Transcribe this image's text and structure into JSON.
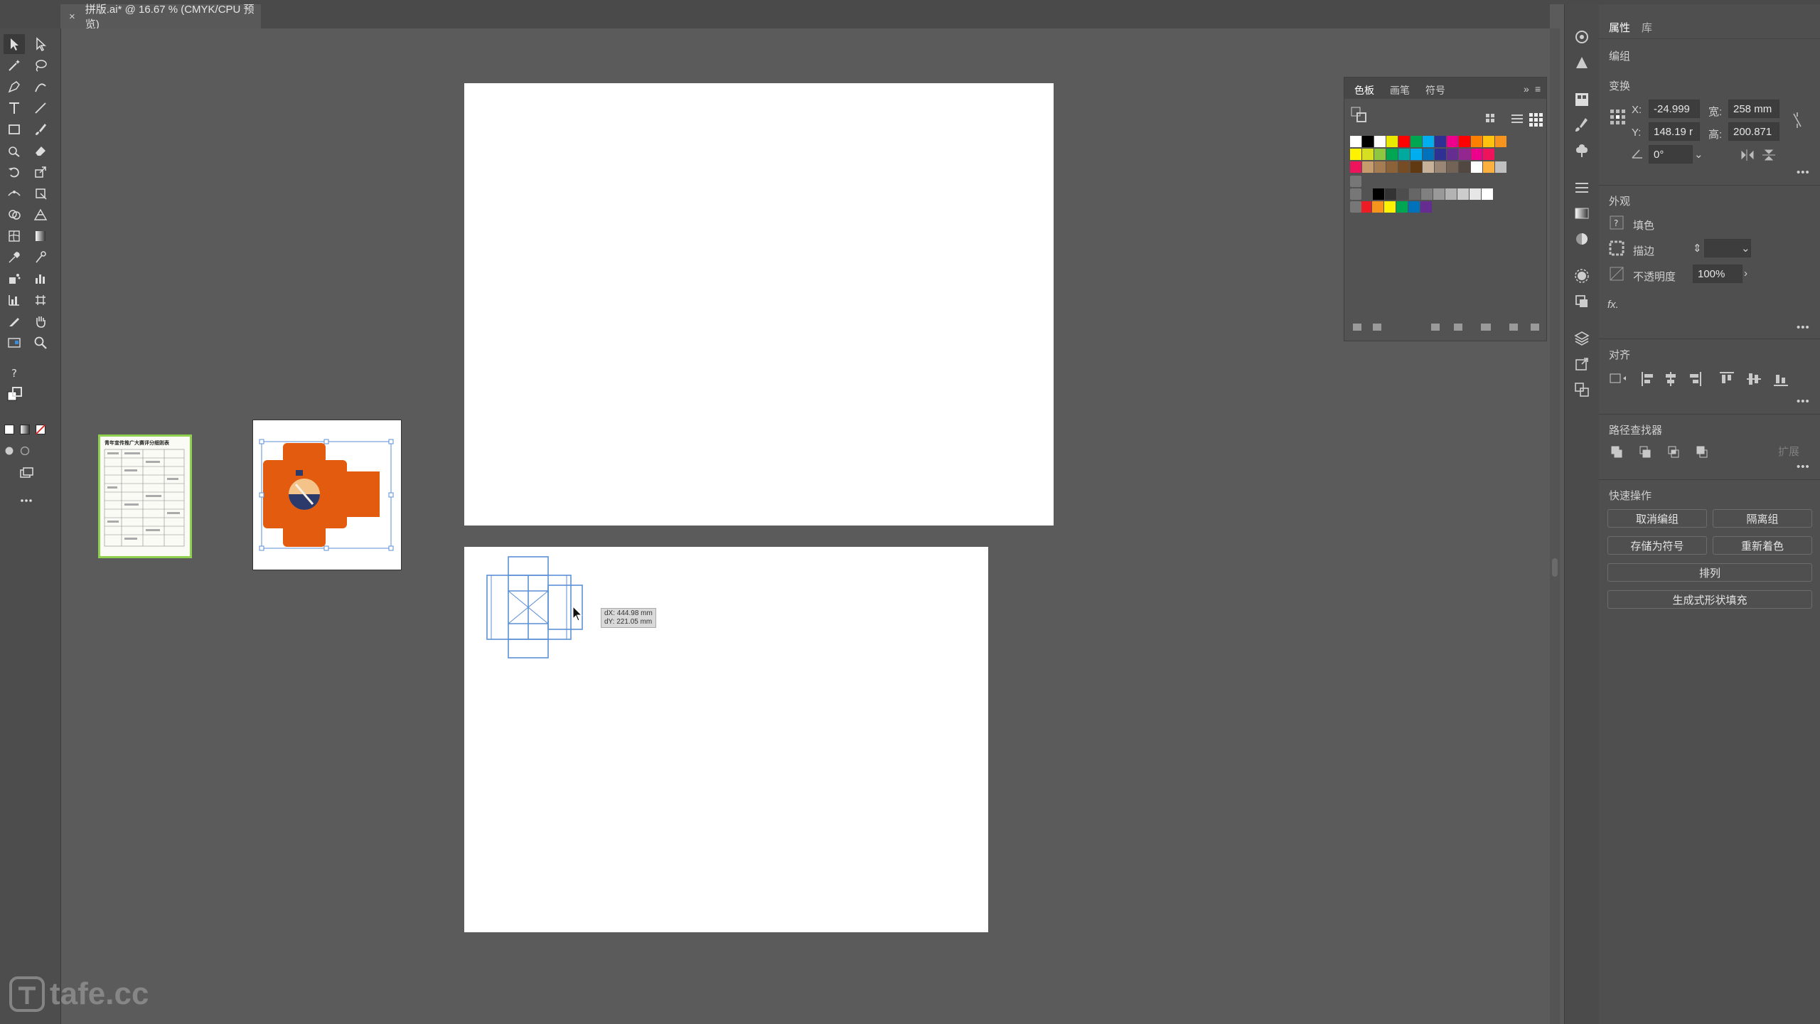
{
  "document_tab": {
    "close_glyph": "×",
    "title": "拼版.ai* @ 16.67 % (CMYK/CPU 预览)"
  },
  "panel_tabs": {
    "properties": "属性",
    "libraries": "库"
  },
  "selection_type": "编组",
  "transform": {
    "title": "变换",
    "x_label": "X:",
    "x_value": "-24.999",
    "y_label": "Y:",
    "y_value": "148.19 r",
    "w_label": "宽:",
    "w_value": "258 mm",
    "h_label": "高:",
    "h_value": "200.871",
    "angle_value": "0°"
  },
  "appearance": {
    "title": "外观",
    "fill_label": "填色",
    "stroke_label": "描边",
    "opacity_label": "不透明度",
    "opacity_value": "100%",
    "fx_label": "fx."
  },
  "align": {
    "title": "对齐"
  },
  "pathfinder": {
    "title": "路径查找器",
    "expand_label": "扩展"
  },
  "quick_actions": {
    "title": "快速操作",
    "ungroup": "取消编组",
    "isolate": "隔离组",
    "save_symbol": "存储为符号",
    "recolor": "重新着色",
    "arrange": "排列",
    "generative_fill": "生成式形状填充"
  },
  "swatches_panel": {
    "tabs": [
      "色板",
      "画笔",
      "符号"
    ],
    "colors_row1": [
      "#ffffff",
      "#000000",
      "#ffffff",
      "#e8e800",
      "#ff0000",
      "#00a650",
      "#00aeef",
      "#2e3192",
      "#ec008c",
      "#ff0000",
      "#ff7f00",
      "#ffc20e",
      "#f7941d"
    ],
    "colors_row2": [
      "#fff200",
      "#d7df23",
      "#8dc63f",
      "#00a651",
      "#00a99d",
      "#00aeef",
      "#0072bc",
      "#2e3192",
      "#662d91",
      "#92278f",
      "#ec008c",
      "#ed145b"
    ],
    "colors_row3": [
      "#ed145b",
      "#c69c6d",
      "#a67c52",
      "#8c6239",
      "#754c24",
      "#603913",
      "#c7b299",
      "#998675",
      "#736357",
      "#534741",
      "#fff",
      "#fbb040",
      "#c0c0c0"
    ],
    "colors_row5": [
      "#000000",
      "#333333",
      "#4d4d4d",
      "#666666",
      "#808080",
      "#999999",
      "#b3b3b3",
      "#cccccc",
      "#e6e6e6",
      "#ffffff"
    ],
    "colors_row6": [
      "#ed1c24",
      "#f7941d",
      "#fff200",
      "#00a651",
      "#0072bc",
      "#662d91"
    ]
  },
  "cursor_tooltip": {
    "dx": "dX: 444.98 mm",
    "dy": "dY: 221.05 mm"
  },
  "thumbnail_doc": {
    "heading": "青年宣传推广大赛评分细则表"
  },
  "watermark": "tafe.cc"
}
